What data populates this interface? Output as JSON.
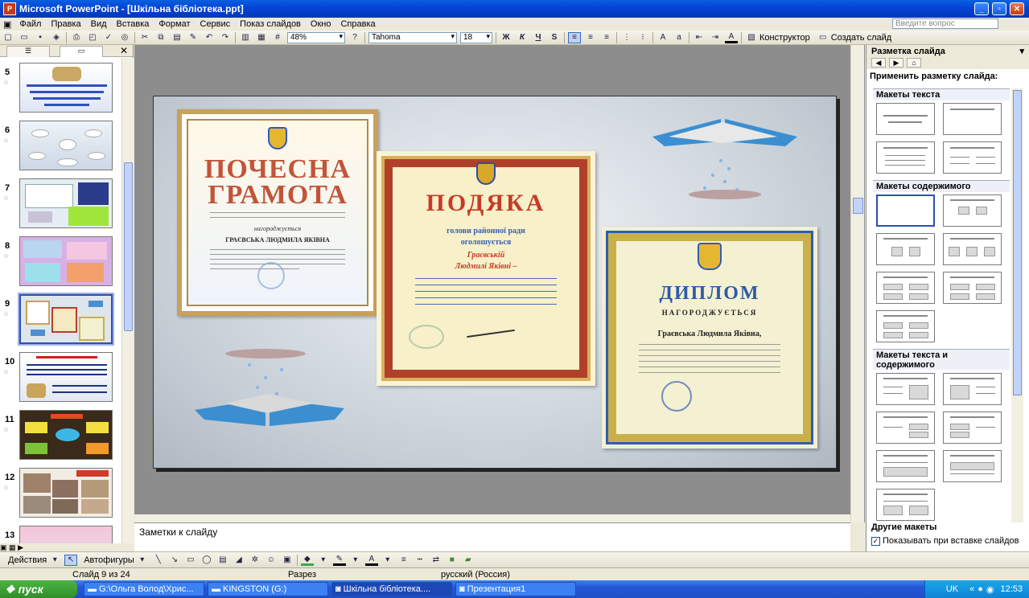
{
  "window": {
    "title": "Microsoft PowerPoint - [Шкільна бібліотека.ppt]",
    "min": "_",
    "max": "▫",
    "close": "✕"
  },
  "menu": [
    "Файл",
    "Правка",
    "Вид",
    "Вставка",
    "Формат",
    "Сервис",
    "Показ слайдов",
    "Окно",
    "Справка"
  ],
  "ask_placeholder": "Введите вопрос",
  "toolbar": {
    "zoom": "48%",
    "font": "Tahoma",
    "size": "18",
    "bold": "Ж",
    "italic": "К",
    "underline": "Ч",
    "shadow": "S",
    "designer": "Конструктор",
    "new_slide": "Создать слайд"
  },
  "slides": [
    {
      "num": "5"
    },
    {
      "num": "6"
    },
    {
      "num": "7"
    },
    {
      "num": "8"
    },
    {
      "num": "9"
    },
    {
      "num": "10"
    },
    {
      "num": "11"
    },
    {
      "num": "12"
    },
    {
      "num": "13"
    }
  ],
  "slide": {
    "cert1": {
      "title1": "ПОЧЕСНА",
      "title2": "ГРАМОТА",
      "sub": "нагороджується",
      "name": "ГРАЄВСЬКА ЛЮДМИЛА ЯКІВНА"
    },
    "cert2": {
      "title": "ПОДЯКА",
      "l1": "голови районної ради",
      "l2": "оголошується",
      "l3": "Граєвській",
      "l4": "Людмилі Яківні –"
    },
    "cert3": {
      "title": "ДИПЛОМ",
      "sub": "НАГОРОДЖУЄТЬСЯ",
      "name": "Граєвська Людмила Яківна,"
    }
  },
  "task_pane": {
    "title": "Разметка слайда",
    "apply": "Применить разметку слайда:",
    "cat1": "Макеты текста",
    "cat2": "Макеты содержимого",
    "cat3": "Макеты текста и содержимого",
    "more": "Другие макеты",
    "show": "Показывать при вставке слайдов"
  },
  "notes": "Заметки к слайду",
  "drawbar": {
    "actions": "Действия",
    "autoshapes": "Автофигуры"
  },
  "status": {
    "slide": "Слайд 9 из 24",
    "design": "Разрез",
    "lang": "русский (Россия)"
  },
  "taskbar": {
    "start": "пуск",
    "tasks": [
      "G:\\Ольга Волод\\Хрис...",
      "KINGSTON (G:)",
      "Шкільна бібліотека....",
      "Презентация1"
    ],
    "lang": "UK",
    "clock": "12:53"
  }
}
